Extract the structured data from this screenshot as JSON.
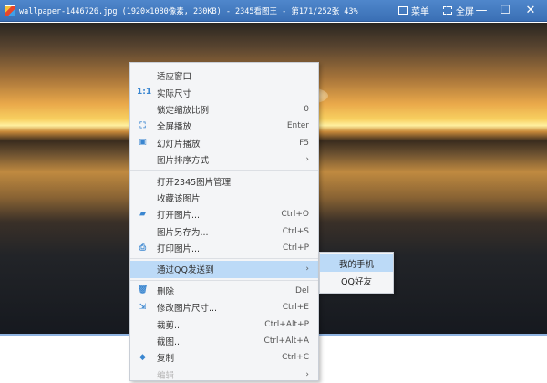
{
  "titlebar": {
    "title": "wallpaper-1446726.jpg (1920×1080像素, 230KB) - 2345看图王 - 第171/252张 43%",
    "menu_label": "菜单",
    "fullscreen_label": "全屏",
    "minimize": "—",
    "maximize": "☐",
    "close": "✕"
  },
  "menu": {
    "items": [
      {
        "label": "适应窗口",
        "shortcut": ""
      },
      {
        "label": "实际尺寸",
        "shortcut": "",
        "icon": "1:1"
      },
      {
        "label": "锁定缩放比例",
        "shortcut": "0"
      },
      {
        "label": "全屏播放",
        "shortcut": "Enter",
        "icon": "⛶"
      },
      {
        "label": "幻灯片播放",
        "shortcut": "F5",
        "icon": "▣"
      },
      {
        "label": "图片排序方式",
        "shortcut": "›"
      },
      {
        "label": "打开2345图片管理",
        "shortcut": ""
      },
      {
        "label": "收藏该图片",
        "shortcut": ""
      },
      {
        "label": "打开图片...",
        "shortcut": "Ctrl+O",
        "icon": "▰"
      },
      {
        "label": "图片另存为...",
        "shortcut": "Ctrl+S"
      },
      {
        "label": "打印图片...",
        "shortcut": "Ctrl+P",
        "icon": "⎙"
      },
      {
        "label": "通过QQ发送到",
        "shortcut": "›"
      },
      {
        "label": "删除",
        "shortcut": "Del",
        "icon": "🗑"
      },
      {
        "label": "修改图片尺寸...",
        "shortcut": "Ctrl+E",
        "icon": "⇲"
      },
      {
        "label": "裁剪...",
        "shortcut": "Ctrl+Alt+P"
      },
      {
        "label": "截图...",
        "shortcut": "Ctrl+Alt+A"
      },
      {
        "label": "复制",
        "shortcut": "Ctrl+C",
        "icon": "◆"
      },
      {
        "label": "编辑",
        "shortcut": "›"
      }
    ]
  },
  "submenu": {
    "items": [
      "我的手机",
      "QQ好友"
    ]
  }
}
